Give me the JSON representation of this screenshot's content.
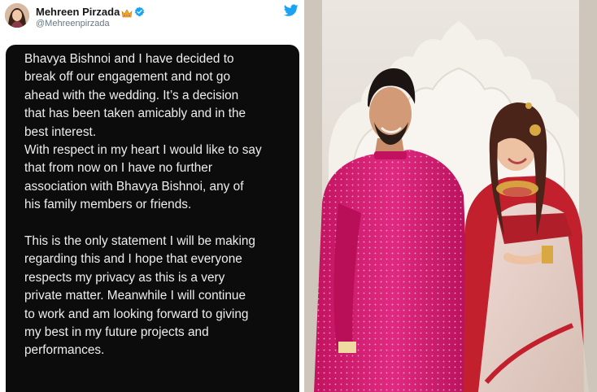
{
  "profile": {
    "display_name": "Mehreen Pirzada",
    "handle": "@Mehreenpirzada",
    "avatar_icon": "profile-photo",
    "verified_icon": "verified-badge-icon",
    "emoji_icon": "crown-emoji-icon",
    "logo_icon": "twitter-bird-icon"
  },
  "statement": {
    "paragraph1": [
      "Bhavya Bishnoi and I have decided to",
      "break off our engagement and not go",
      "ahead with the wedding. It’s a decision",
      "that has been taken amicably and in the",
      "best interest.",
      "With respect in my heart I would like to say",
      "that from now on I have no further",
      "association with Bhavya Bishnoi, any of",
      "his family members or friends."
    ],
    "paragraph2": [
      "This is the only statement I will be making",
      "regarding this and I hope that everyone",
      "respects my privacy as this is a very",
      "private matter.  Meanwhile I will continue",
      "to work and am looking forward to giving",
      "my best in my future projects and",
      "performances."
    ]
  },
  "colors": {
    "twitter_blue": "#1da1f2",
    "statement_bg": "#0c0c0c",
    "kurta_pink": "#d81f76",
    "saree_red": "#c2202c"
  }
}
